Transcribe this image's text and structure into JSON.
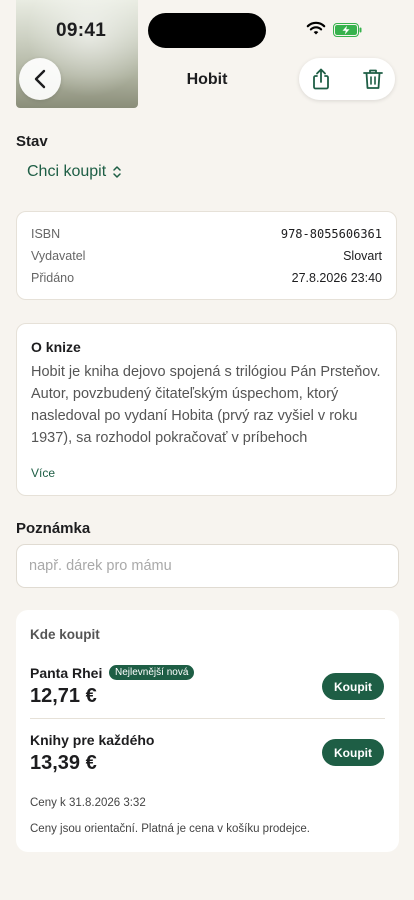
{
  "status_bar": {
    "time": "09:41"
  },
  "nav": {
    "title": "Hobit"
  },
  "status_section": {
    "label": "Stav",
    "value": "Chci koupit"
  },
  "info": {
    "rows": [
      {
        "key": "ISBN",
        "value": "978-8055606361"
      },
      {
        "key": "Vydavatel",
        "value": "Slovart"
      },
      {
        "key": "Přidáno",
        "value": "27.8.2026 23:40"
      }
    ]
  },
  "about": {
    "title": "O knize",
    "text": "Hobit je kniha dejovo spojená s trilógiou Pán Prsteňov. Autor, povzbudený čitateľským úspechom, ktorý nasledoval po vydaní Hobita (prvý raz vyšiel v roku 1937), sa rozhodol pokračovať v príbehoch Stredozeme a rozšíriť ich; tak sa zrodil t…",
    "more": "Více"
  },
  "note": {
    "label": "Poznámka",
    "placeholder": "např. dárek pro mámu"
  },
  "buy": {
    "title": "Kde koupit",
    "stores": [
      {
        "name": "Panta Rhei",
        "badge": "Nejlevnější nová",
        "price": "12,71 €",
        "button": "Koupit"
      },
      {
        "name": "Knihy pre každého",
        "price": "13,39 €",
        "button": "Koupit"
      }
    ],
    "prices_date": "Ceny k 31.8.2026 3:32",
    "disclaimer": "Ceny jsou orientační. Platná je cena v košíku prodejce."
  },
  "colors": {
    "accent": "#1e5e45",
    "background": "#f7f4ef"
  }
}
